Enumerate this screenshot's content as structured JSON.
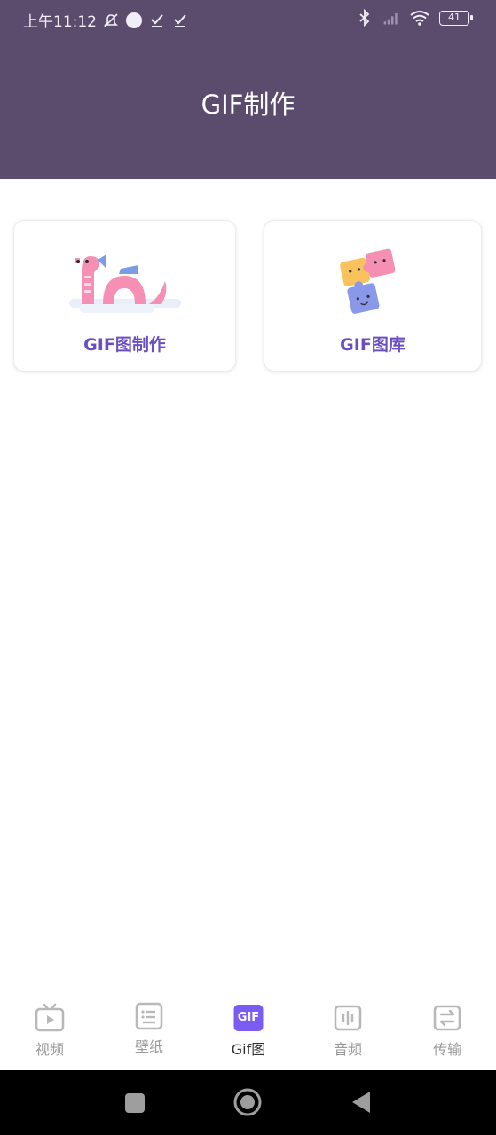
{
  "status_bar": {
    "time": "上午11:12",
    "battery": "41",
    "icons": [
      "mute-icon",
      "dot-icon",
      "check-icon",
      "check-icon",
      "bluetooth-icon",
      "signal-icon",
      "wifi-icon",
      "battery-icon"
    ]
  },
  "header": {
    "title": "GIF制作"
  },
  "cards": [
    {
      "label": "GIF图制作",
      "icon": "dinosaur-illustration"
    },
    {
      "label": "GIF图库",
      "icon": "puzzle-illustration"
    }
  ],
  "bottom_nav": {
    "items": [
      {
        "label": "视频",
        "icon": "tv-icon",
        "active": false
      },
      {
        "label": "壁纸",
        "icon": "list-icon",
        "active": false
      },
      {
        "label": "Gif图",
        "icon": "gif-icon",
        "active": true,
        "icon_text": "GIF"
      },
      {
        "label": "音频",
        "icon": "audio-icon",
        "active": false
      },
      {
        "label": "传输",
        "icon": "transfer-icon",
        "active": false
      }
    ]
  },
  "colors": {
    "header_bg": "#5b4b6d",
    "card_label": "#6a4fc2",
    "active_icon": "#7b5cf0",
    "inactive": "#9a9a9a"
  }
}
